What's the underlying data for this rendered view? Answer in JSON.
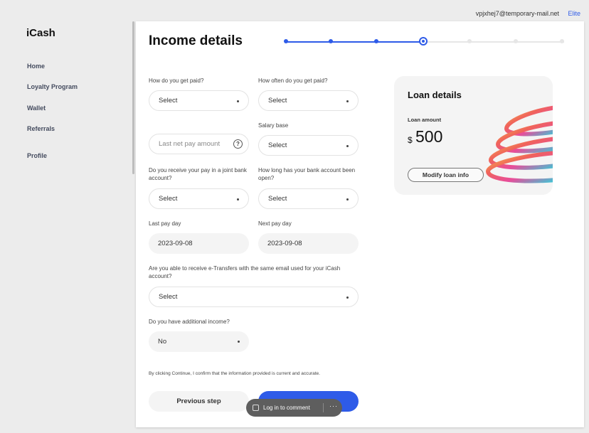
{
  "header": {
    "email": "vpjxhej7@temporary-mail.net",
    "tier": "Elite"
  },
  "sidebar": {
    "logo": "iCash",
    "items": [
      {
        "label": "Home"
      },
      {
        "label": "Loyalty Program"
      },
      {
        "label": "Wallet"
      },
      {
        "label": "Referrals"
      },
      {
        "label": "Profile"
      }
    ]
  },
  "page": {
    "title": "Income details",
    "stepper": {
      "total_steps": 7,
      "current_step": 4
    }
  },
  "form": {
    "paid_how": {
      "label": "How do you get paid?",
      "value": "Select"
    },
    "paid_often": {
      "label": "How often do you get paid?",
      "value": "Select"
    },
    "net_pay": {
      "placeholder": "Last net pay amount"
    },
    "salary_base": {
      "label": "Salary base",
      "value": "Select"
    },
    "joint_account": {
      "label": "Do you receive your pay in a joint bank account?",
      "value": "Select"
    },
    "account_age": {
      "label": "How long has your bank account been open?",
      "value": "Select"
    },
    "last_pay_day": {
      "label": "Last pay day",
      "value": "2023-09-08"
    },
    "next_pay_day": {
      "label": "Next pay day",
      "value": "2023-09-08"
    },
    "etransfer": {
      "label": "Are you able to receive e-Transfers with the same email used for your iCash account?",
      "value": "Select"
    },
    "additional_income": {
      "label": "Do you have additional income?",
      "value": "No"
    },
    "confirm_text": "By clicking Continue, I confirm that the information provided is current and accurate.",
    "prev_button": "Previous step"
  },
  "loan": {
    "title": "Loan details",
    "amount_label": "Loan amount",
    "currency": "$",
    "amount": "500",
    "modify_button": "Modify loan info"
  },
  "comment": {
    "label": "Log in to comment",
    "more": "···"
  },
  "colors": {
    "accent": "#2e5be8"
  }
}
